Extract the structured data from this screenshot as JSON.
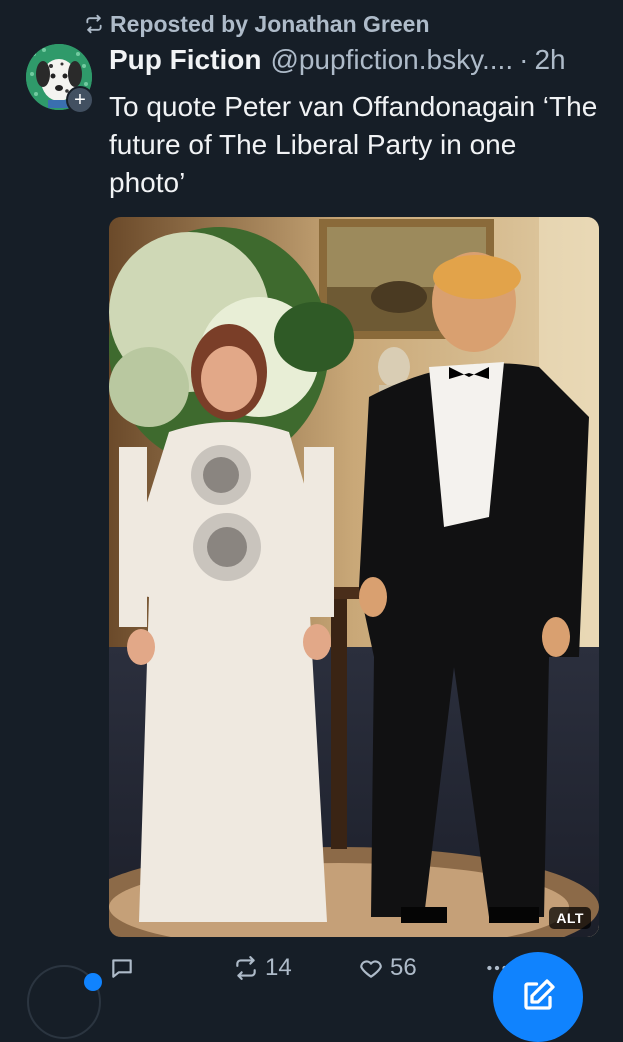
{
  "repost": {
    "label": "Reposted by Jonathan Green",
    "icon": "repost-icon"
  },
  "post": {
    "display_name": "Pup Fiction",
    "handle": "@pupfiction.bsky....",
    "separator": "·",
    "time": "2h",
    "text": "To quote Peter van Offandonagain ‘The future of The Liberal Party in one photo’",
    "image_alt_badge": "ALT",
    "avatar_icon": "dalmatian-avatar"
  },
  "actions": {
    "reply": {
      "icon": "reply-icon",
      "count": ""
    },
    "repost": {
      "icon": "repost-icon",
      "count": "14"
    },
    "like": {
      "icon": "heart-icon",
      "count": "56"
    },
    "more": {
      "icon": "more-icon"
    }
  },
  "compose": {
    "icon": "compose-icon"
  },
  "colors": {
    "background": "#161e27",
    "muted_text": "#aebbc9",
    "accent": "#1083fe"
  }
}
